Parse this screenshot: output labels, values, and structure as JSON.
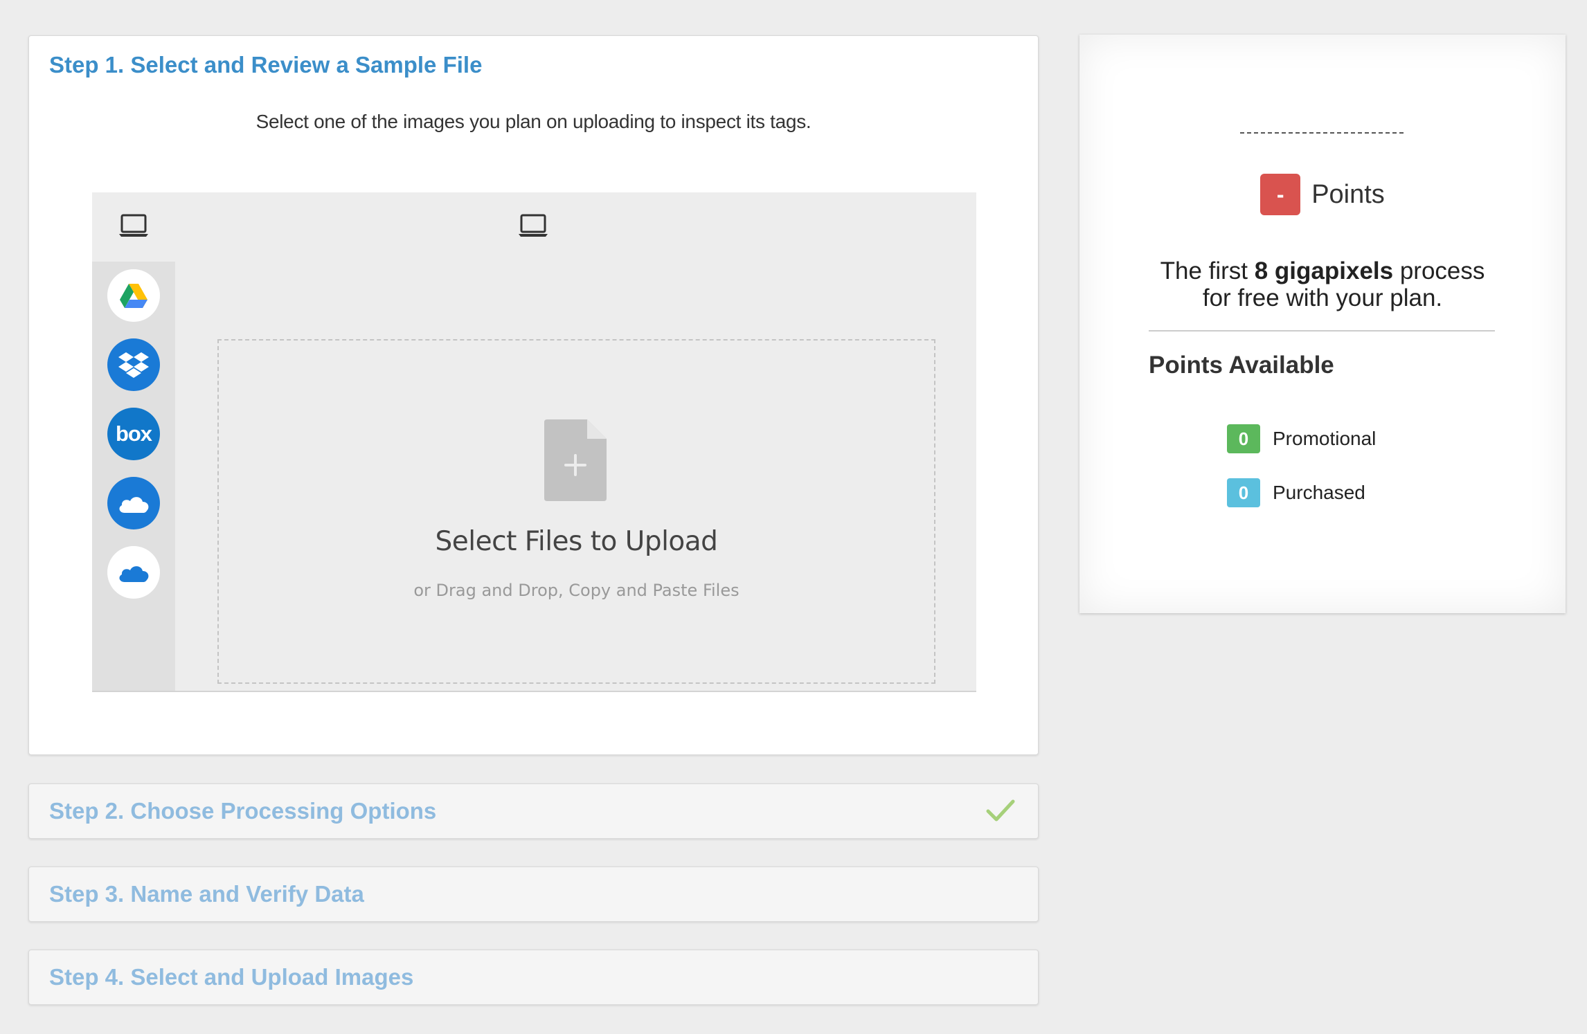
{
  "steps": {
    "step1": {
      "title": "Step 1. Select and Review a Sample File",
      "description": "Select one of the images you plan on uploading to inspect its tags."
    },
    "step2": {
      "title": "Step 2. Choose Processing Options",
      "status_icon": "checkmark-icon"
    },
    "step3": {
      "title": "Step 3. Name and Verify Data"
    },
    "step4": {
      "title": "Step 4. Select and Upload Images"
    }
  },
  "picker": {
    "topbar_icons": [
      "laptop-icon",
      "laptop-icon"
    ],
    "sources": [
      {
        "name": "google-drive",
        "icon": "google-drive-icon"
      },
      {
        "name": "dropbox",
        "icon": "dropbox-icon"
      },
      {
        "name": "box",
        "icon": "box-icon",
        "text": "box"
      },
      {
        "name": "onedrive",
        "icon": "onedrive-icon"
      },
      {
        "name": "onedrive-business",
        "icon": "cloud-icon"
      }
    ],
    "drop_title": "Select Files to Upload",
    "drop_subtitle": "or Drag and Drop, Copy and Paste Files"
  },
  "points_card": {
    "dashes": "------------------------",
    "badge": "-",
    "points_label": "Points",
    "free_note_prefix": "The first ",
    "free_note_bold": "8 gigapixels",
    "free_note_mid": " process",
    "free_note_line2": "for free with your plan.",
    "available_title": "Points Available",
    "promotional": {
      "value": "0",
      "label": "Promotional"
    },
    "purchased": {
      "value": "0",
      "label": "Purchased"
    }
  },
  "colors": {
    "step_title_active": "#3b8ec9",
    "step_title_inactive": "#8fbbdf",
    "points_badge": "#d9534f",
    "promo_badge": "#5cb85c",
    "purchased_badge": "#5bc0de",
    "check": "#a6d07a"
  }
}
